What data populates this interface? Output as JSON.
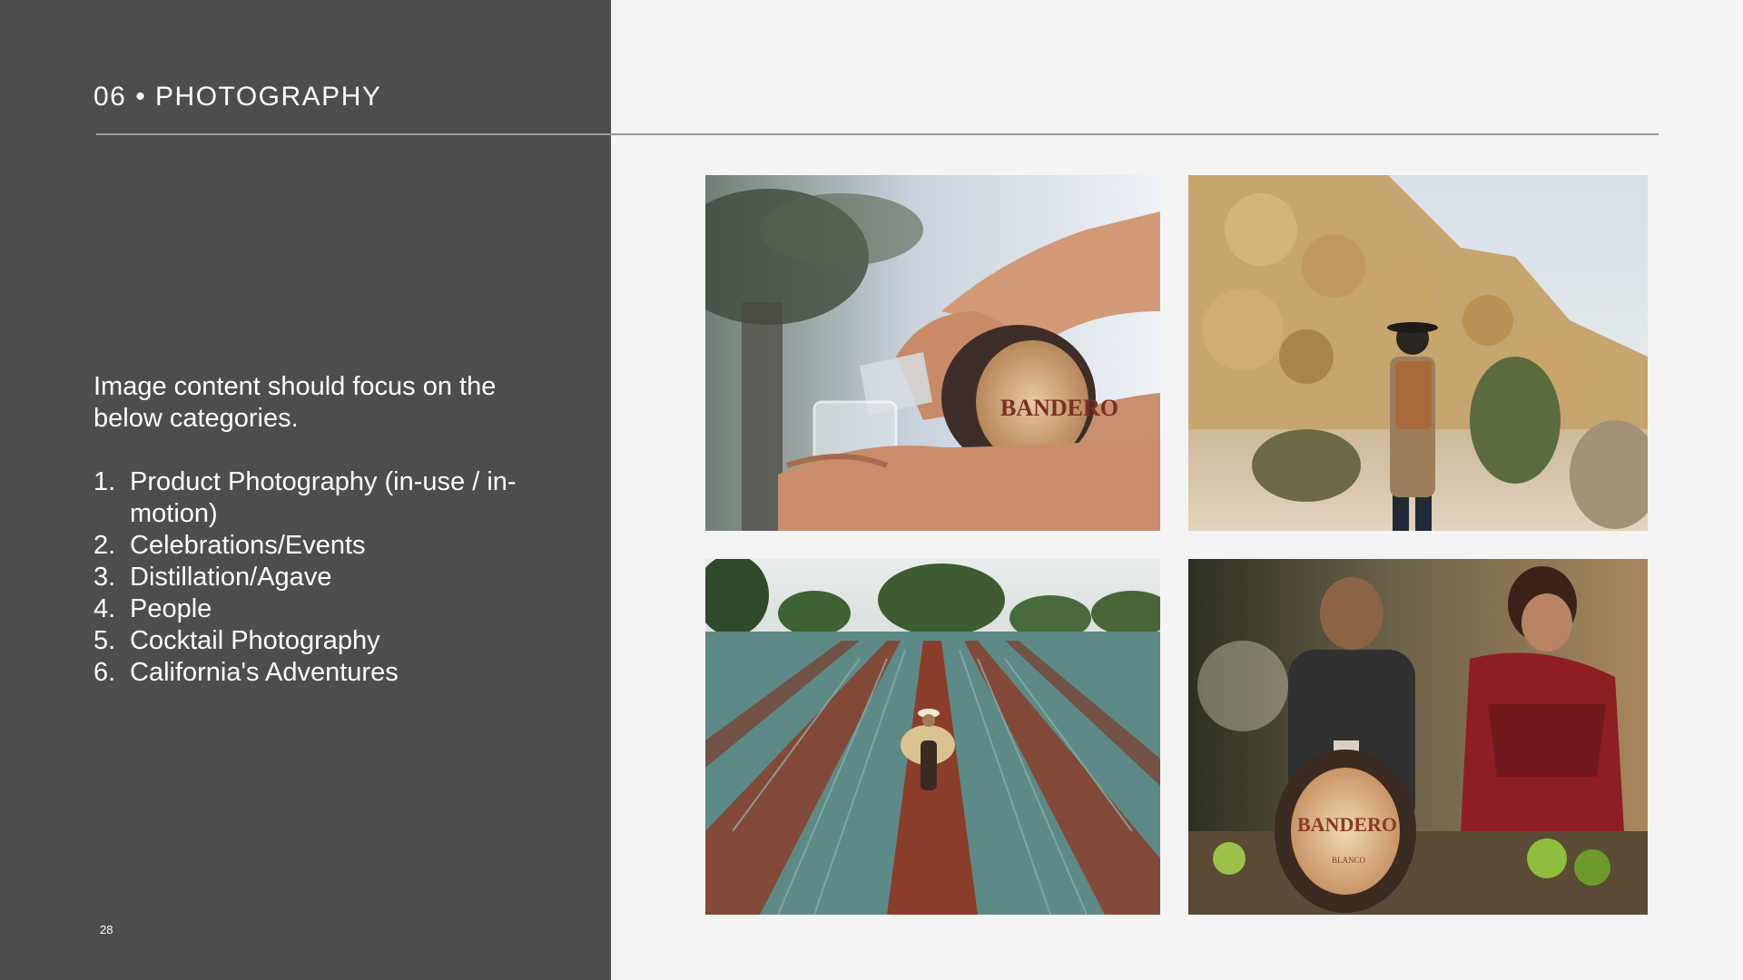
{
  "header": {
    "title": "06 • PHOTOGRAPHY"
  },
  "body": {
    "intro": "Image content should focus on the below categories.",
    "categories": [
      {
        "num": "1.",
        "label": "Product Photography (in-use / in-motion)"
      },
      {
        "num": "2.",
        "label": "Celebrations/Events"
      },
      {
        "num": "3.",
        "label": "Distillation/Agave"
      },
      {
        "num": "4.",
        "label": "People"
      },
      {
        "num": "5.",
        "label": "Cocktail Photography"
      },
      {
        "num": "6.",
        "label": "California's Adventures"
      }
    ]
  },
  "footer": {
    "page_number": "28"
  },
  "photos": {
    "pour": {
      "label_text": "BANDERO"
    },
    "party": {
      "label_brand": "BANDERO",
      "label_sub": "BLANCO"
    }
  },
  "colors": {
    "panel": "#4d4d4d",
    "background": "#f4f4f4",
    "divider": "#9a9a9a"
  }
}
